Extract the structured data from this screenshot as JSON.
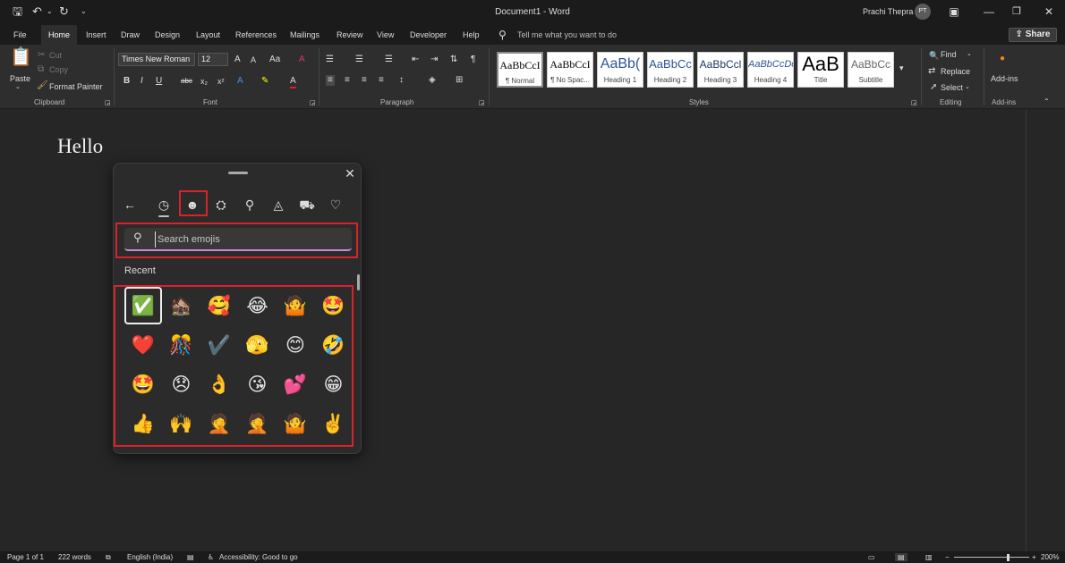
{
  "titlebar": {
    "title": "Document1  -  Word",
    "user_name": "Prachi Thepra",
    "avatar_initials": "PT",
    "icons": [
      "save-icon",
      "undo-icon",
      "redo-icon",
      "customize-icon",
      "ribbon-display-icon",
      "minimize-icon",
      "restore-icon",
      "close-icon"
    ]
  },
  "menu": {
    "tabs": [
      "File",
      "Home",
      "Insert",
      "Draw",
      "Design",
      "Layout",
      "References",
      "Mailings",
      "Review",
      "View",
      "Developer",
      "Help"
    ],
    "active_tab": "Home",
    "tell_me": "Tell me what you want to do",
    "share": "Share"
  },
  "ribbon": {
    "clipboard": {
      "paste": "Paste",
      "cut": "Cut",
      "copy": "Copy",
      "format_painter": "Format Painter",
      "label": "Clipboard"
    },
    "font": {
      "font_name": "Times New Roman",
      "font_size": "12",
      "label": "Font"
    },
    "paragraph": {
      "label": "Paragraph"
    },
    "styles": {
      "items": [
        {
          "preview": "AaBbCcI",
          "name": "¶ Normal"
        },
        {
          "preview": "AaBbCcI",
          "name": "¶ No Spac..."
        },
        {
          "preview": "AaBb(",
          "name": "Heading 1"
        },
        {
          "preview": "AaBbCc",
          "name": "Heading 2"
        },
        {
          "preview": "AaBbCcl",
          "name": "Heading 3"
        },
        {
          "preview": "AaBbCcDc",
          "name": "Heading 4"
        },
        {
          "preview": "AaB",
          "name": "Title"
        },
        {
          "preview": "AaBbCc",
          "name": "Subtitle"
        }
      ],
      "label": "Styles"
    },
    "editing": {
      "find": "Find",
      "replace": "Replace",
      "select": "Select",
      "label": "Editing"
    },
    "addins": {
      "button": "Add-ins",
      "label": "Add-ins"
    }
  },
  "document": {
    "text": "Hello"
  },
  "emoji_panel": {
    "search_placeholder": "Search emojis",
    "section_label": "Recent",
    "categories": [
      "back-icon",
      "recent-icon",
      "emoji-icon",
      "kaomoji-icon",
      "symbols-icon",
      "gif-icon",
      "clipboard-icon",
      "favorites-icon"
    ],
    "emojis": [
      "✅",
      "🏚️",
      "🥰",
      "😂",
      "🤷",
      "🤩",
      "❤️",
      "🎊",
      "✔️",
      "🫣",
      "😊",
      "🤣",
      "🤩",
      "😞",
      "👌",
      "😘",
      "💕",
      "😁",
      "👍",
      "🙌",
      "🤦",
      "🤦",
      "🤷",
      "✌️"
    ]
  },
  "statusbar": {
    "page": "Page 1 of 1",
    "words": "222 words",
    "language": "English (India)",
    "accessibility": "Accessibility: Good to go",
    "zoom": "200%"
  }
}
